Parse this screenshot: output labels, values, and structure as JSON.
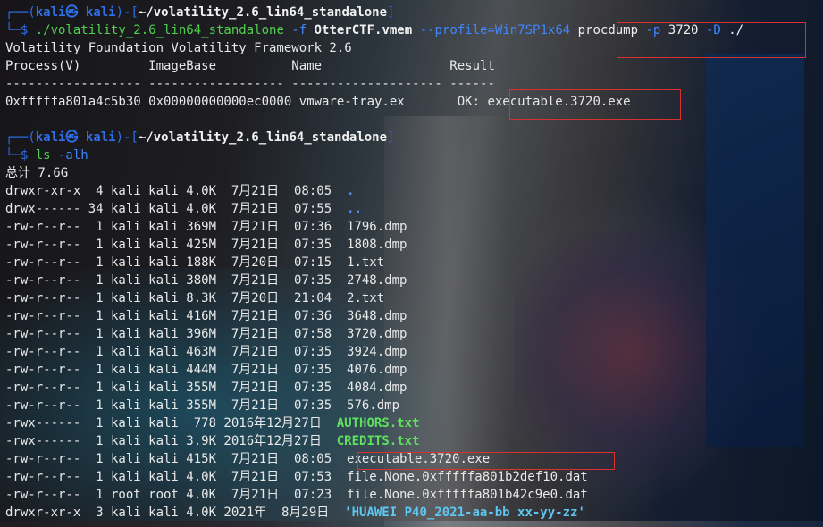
{
  "prompt": {
    "open": "┌──(",
    "user": "kali㉿ kali",
    "mid": ")-[",
    "path": "~/volatility_2.6_lin64_standalone",
    "close": "]",
    "arrow": "└─$ "
  },
  "cmd1": {
    "prog": "./volatility_2.6_lin64_standalone",
    "opt_f": " -f ",
    "file": "OtterCTF.vmem",
    "opt_profile": " --profile=Win7SP1x64 ",
    "plugin": "procdump",
    "opt_p": " -p ",
    "pid": "3720",
    "opt_D": " -D ",
    "dir": "./"
  },
  "output1": {
    "banner": "Volatility Foundation Volatility Framework 2.6",
    "header": "Process(V)         ImageBase          Name                 Result",
    "separator": "------------------ ------------------ -------------------- ------",
    "row_prefix": "0xfffffa801a4c5b30 0x00000000000ec0000 vmware-tray.ex       OK: ",
    "row_result": "executable.3720.exe"
  },
  "cmd2": {
    "prog": "ls",
    "args": " -alh"
  },
  "output2": {
    "total": "总计 7.6G",
    "entries": [
      {
        "meta": "drwxr-xr-x  4 kali kali 4.0K  7月21日  08:05  ",
        "name": ".",
        "kind": "dir"
      },
      {
        "meta": "drwx------ 34 kali kali 4.0K  7月21日  07:55  ",
        "name": "..",
        "kind": "dir"
      },
      {
        "meta": "-rw-r--r--  1 kali kali 369M  7月21日  07:36  ",
        "name": "1796.dmp",
        "kind": "file"
      },
      {
        "meta": "-rw-r--r--  1 kali kali 425M  7月21日  07:35  ",
        "name": "1808.dmp",
        "kind": "file"
      },
      {
        "meta": "-rw-r--r--  1 kali kali 188K  7月20日  07:15  ",
        "name": "1.txt",
        "kind": "file"
      },
      {
        "meta": "-rw-r--r--  1 kali kali 380M  7月21日  07:35  ",
        "name": "2748.dmp",
        "kind": "file"
      },
      {
        "meta": "-rw-r--r--  1 kali kali 8.3K  7月20日  21:04  ",
        "name": "2.txt",
        "kind": "file"
      },
      {
        "meta": "-rw-r--r--  1 kali kali 416M  7月21日  07:36  ",
        "name": "3648.dmp",
        "kind": "file"
      },
      {
        "meta": "-rw-r--r--  1 kali kali 396M  7月21日  07:58  ",
        "name": "3720.dmp",
        "kind": "file"
      },
      {
        "meta": "-rw-r--r--  1 kali kali 463M  7月21日  07:35  ",
        "name": "3924.dmp",
        "kind": "file"
      },
      {
        "meta": "-rw-r--r--  1 kali kali 444M  7月21日  07:35  ",
        "name": "4076.dmp",
        "kind": "file"
      },
      {
        "meta": "-rw-r--r--  1 kali kali 355M  7月21日  07:35  ",
        "name": "4084.dmp",
        "kind": "file"
      },
      {
        "meta": "-rw-r--r--  1 kali kali 355M  7月21日  07:35  ",
        "name": "576.dmp",
        "kind": "file"
      },
      {
        "meta": "-rwx------  1 kali kali  778 2016年12月27日  ",
        "name": "AUTHORS.txt",
        "kind": "exe"
      },
      {
        "meta": "-rwx------  1 kali kali 3.9K 2016年12月27日  ",
        "name": "CREDITS.txt",
        "kind": "exe"
      },
      {
        "meta": "-rw-r--r--  1 kali kali 415K  7月21日  08:05  ",
        "name": "executable.3720.exe",
        "kind": "file"
      },
      {
        "meta": "-rw-r--r--  1 kali kali 4.0K  7月21日  07:53  ",
        "name": "file.None.0xfffffa801b2def10.dat",
        "kind": "file"
      },
      {
        "meta": "-rw-r--r--  1 root root 4.0K  7月21日  07:23  ",
        "name": "file.None.0xfffffa801b42c9e0.dat",
        "kind": "file"
      },
      {
        "meta": "drwxr-xr-x  3 kali kali 4.0K 2021年  8月29日  ",
        "name": "'HUAWEI P40_2021-aa-bb xx-yy-zz'",
        "kind": "dir2"
      }
    ]
  },
  "colors": {
    "prompt_blue": "#2f6fe8",
    "command_green": "#4fd04f",
    "highlight_box_red": "#d9312e"
  }
}
